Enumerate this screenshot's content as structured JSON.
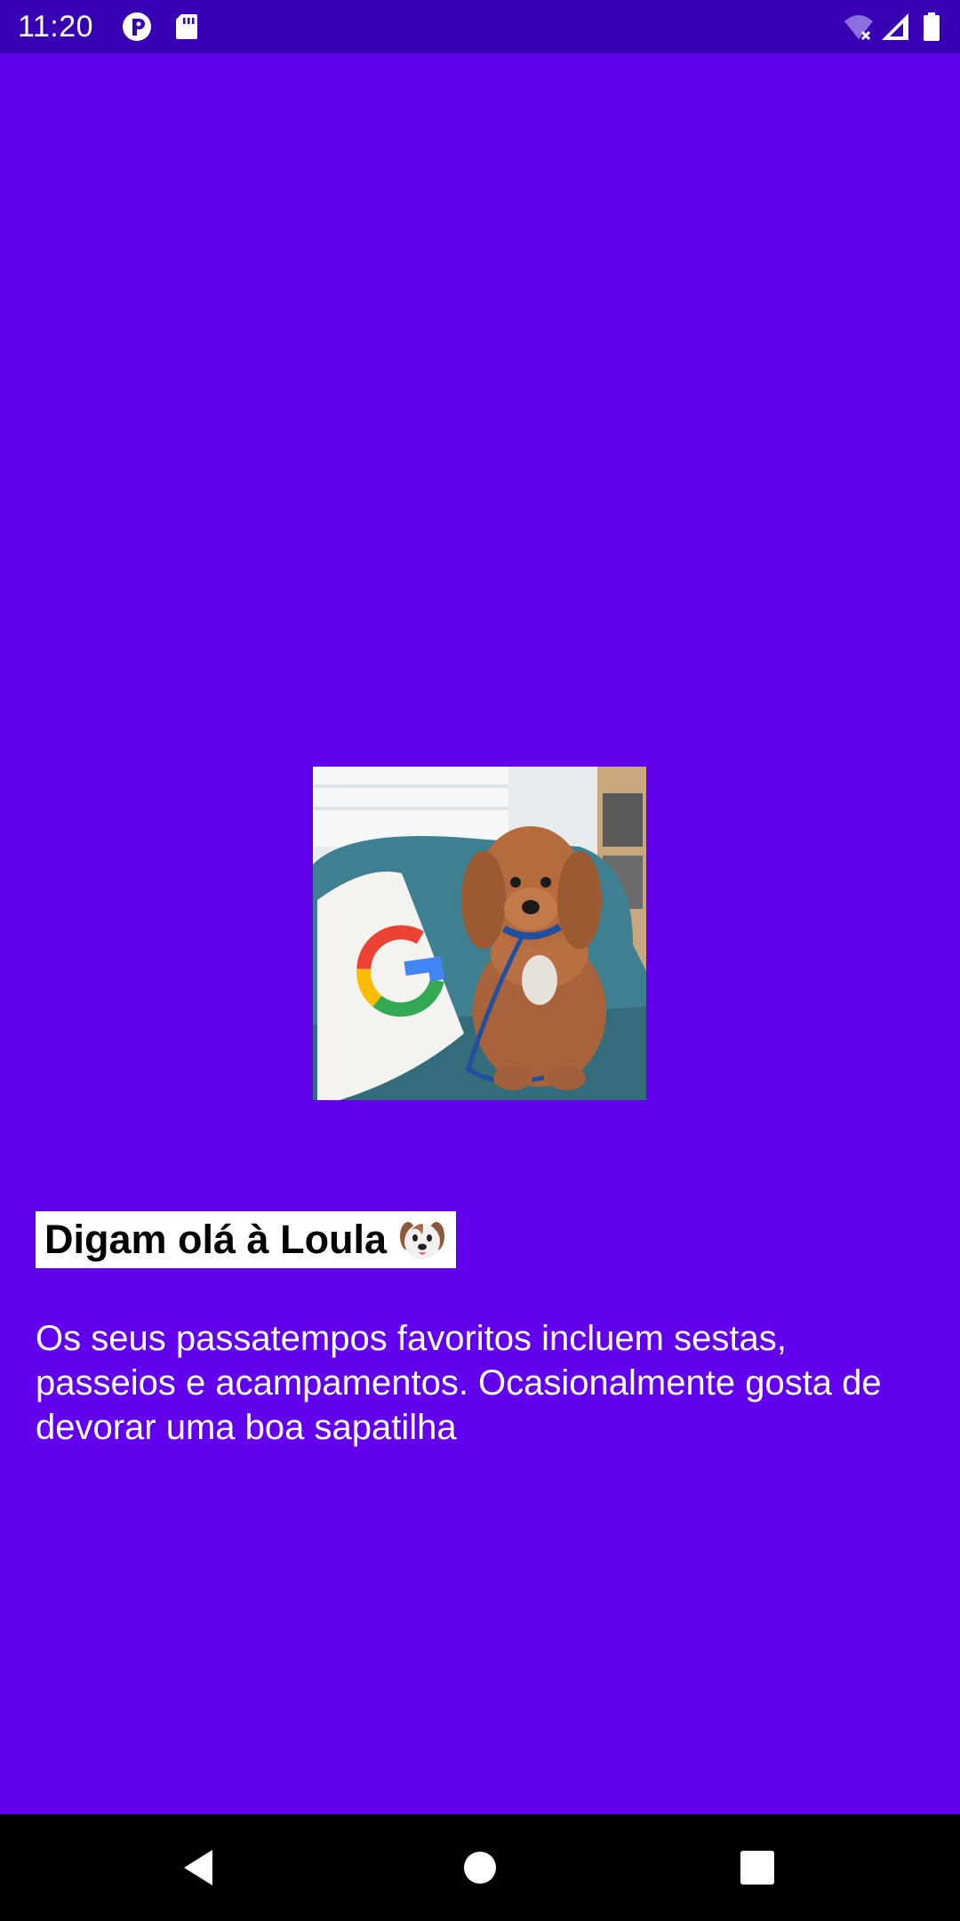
{
  "status_bar": {
    "time": "11:20",
    "icons": [
      "notification-app-icon",
      "sd-card-icon",
      "wifi-off-icon",
      "cell-signal-icon",
      "battery-icon"
    ]
  },
  "content": {
    "photo_description": "dog-photo",
    "title": "Digam olá à Loula",
    "title_emoji_icon": "dog-face-icon",
    "description": "Os seus passatempos favoritos incluem sestas, passeios e acampamentos. Ocasionalmente gosta de devorar uma boa sapatilha"
  },
  "nav_bar": {
    "buttons": [
      "back-icon",
      "home-icon",
      "recents-icon"
    ]
  },
  "colors": {
    "background": "#6200EE",
    "status_bar": "#3700B3",
    "title_background": "#FFFFFF",
    "nav_bar": "#000000"
  }
}
